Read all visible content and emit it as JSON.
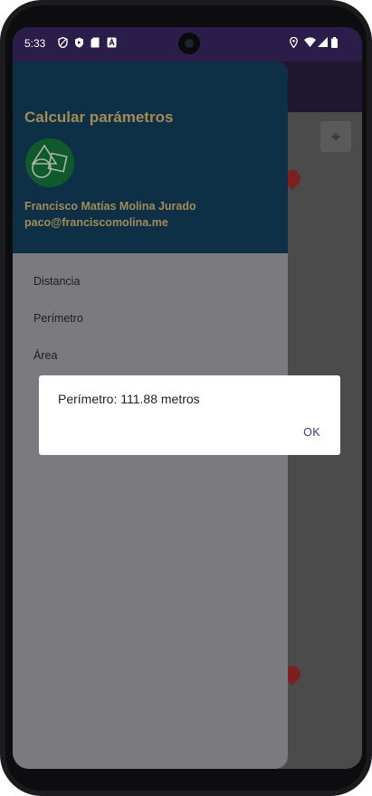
{
  "status": {
    "time": "5:33"
  },
  "drawer": {
    "title": "Calcular parámetros",
    "user_name": "Francisco Matías Molina Jurado",
    "user_email": "paco@franciscomolina.me",
    "menu": [
      "Distancia",
      "Perímetro",
      "Área"
    ]
  },
  "dialog": {
    "message": "Perímetro: 111.88 metros",
    "ok_label": "OK"
  },
  "colors": {
    "statusbar": "#2b1d4a",
    "drawer_header": "#0d3046",
    "header_text": "#a48a56",
    "avatar_bg": "#10592c",
    "dialog_button": "#3b3880"
  },
  "icons": [
    "shield-icon",
    "play-protect-icon",
    "sd-card-icon",
    "a-badge-icon",
    "location-icon",
    "wifi-icon",
    "signal-icon",
    "battery-icon",
    "my-location-icon",
    "geometry-shapes-icon"
  ]
}
